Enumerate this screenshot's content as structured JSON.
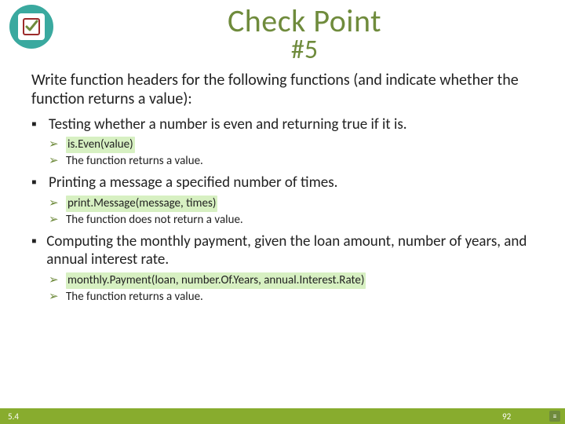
{
  "header": {
    "title_main": "Check Point",
    "title_sub": "#5",
    "icon_name": "checkbox-icon"
  },
  "prompt": "Write function headers for the following functions (and indicate whether the function returns a value):",
  "items": [
    {
      "text": "Testing whether a number is even and returning true if it is.",
      "signature": "is.Even(value)",
      "return_line": "The function returns a value."
    },
    {
      "text": "Printing a message a specified number of times.",
      "signature": "print.Message(message, times)",
      "return_line": "The function does not return a value."
    },
    {
      "text": "Computing the monthly payment, given the loan amount, number of years, and annual interest rate.",
      "signature": "monthly.Payment(loan, number.Of.Years, annual.Interest.Rate)",
      "return_line": "The function returns a value."
    }
  ],
  "footer": {
    "left": "5.4",
    "right": "92"
  },
  "glyphs": {
    "square_bullet": "▪",
    "chevron": "➢"
  }
}
